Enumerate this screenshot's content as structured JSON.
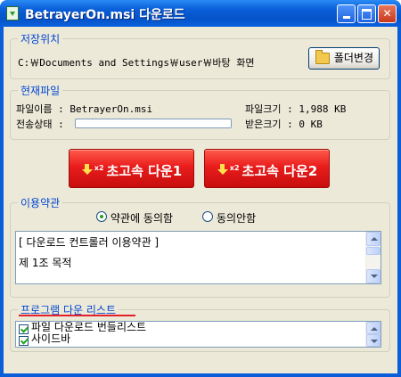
{
  "window": {
    "title": "BetrayerOn.msi 다운로드",
    "controls": {
      "minimize": "minimize-icon",
      "maximize": "maximize-icon",
      "close": "close-icon"
    }
  },
  "save_location": {
    "legend": "저장위치",
    "path": "C:￦Documents and Settings￦user￦바탕 화면",
    "change_folder_label": "폴더변경"
  },
  "current_file": {
    "legend": "현재파일",
    "filename_label": "파일이름 : BetrayerOn.msi",
    "status_label": "전송상태 :",
    "file_size_label": "파일크기 : 1,988 KB",
    "received_label": "받은크기 : 0 KB",
    "progress_fraction": 0
  },
  "download_buttons": [
    {
      "label": "초고속 다운1",
      "badge": "x2"
    },
    {
      "label": "초고속 다운2",
      "badge": "x2"
    }
  ],
  "terms": {
    "legend": "이용약관",
    "agree_label": "약관에 동의함",
    "disagree_label": "동의안함",
    "selected": "agree",
    "text_line1": "[ 다운로드 컨트롤러 이용약관 ]",
    "text_line2": "제 1조 목적"
  },
  "program_list": {
    "legend": "프로그램 다운 리스트",
    "items": [
      {
        "label": "파일 다운로드 번들리스트",
        "checked": true
      },
      {
        "label": "사이드바",
        "checked": true
      }
    ]
  },
  "colors": {
    "accent_red": "#e91d1d",
    "legend_blue": "#0046d5",
    "underline_red": "#e4202a"
  }
}
